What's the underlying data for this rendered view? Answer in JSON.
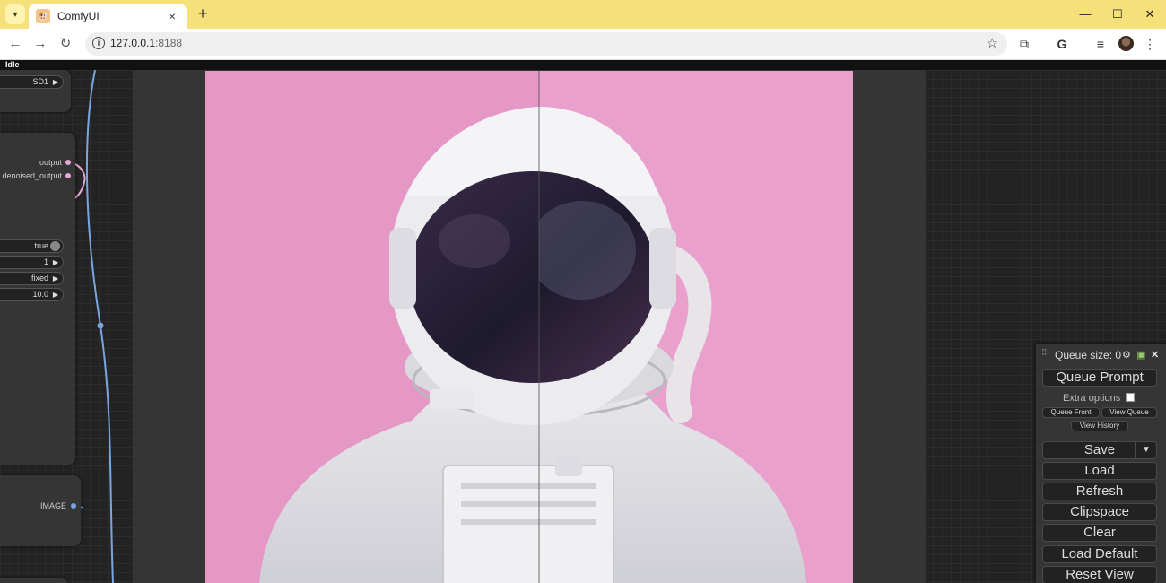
{
  "browser": {
    "tab_title": "ComfyUI",
    "new_tab_label": "+",
    "url_host": "127.0.0.1",
    "url_port": ":8188",
    "icons": [
      "tab-search-icon",
      "favicon-icon",
      "close-icon",
      "minimize-icon",
      "maximize-icon",
      "window-close-icon",
      "back-icon",
      "forward-icon",
      "reload-icon",
      "site-info-icon",
      "bookmark-star-icon",
      "extensions-icon",
      "google-icon",
      "media-controls-icon",
      "profile-avatar",
      "more-menu-icon"
    ]
  },
  "status": {
    "text": "Idle"
  },
  "nodes": {
    "top_node": {
      "model_value": "SD1"
    },
    "sampler_node": {
      "outputs": [
        "output",
        "denoised_output"
      ],
      "widgets": [
        {
          "value": "true",
          "kind": "toggle"
        },
        {
          "value": "1",
          "kind": "number"
        },
        {
          "value": "fixed",
          "kind": "combo"
        },
        {
          "value": "10.0",
          "kind": "number"
        }
      ]
    },
    "image_node": {
      "output_label": "IMAGE"
    }
  },
  "menu": {
    "queue_size_label": "Queue size: 0",
    "queue_prompt": "Queue Prompt",
    "extra_options": "Extra options",
    "queue_front": "Queue Front",
    "view_queue": "View Queue",
    "view_history": "View History",
    "save": "Save",
    "save_dropdown": "▼",
    "load": "Load",
    "refresh": "Refresh",
    "clipspace": "Clipspace",
    "clear": "Clear",
    "load_default": "Load Default",
    "reset_view": "Reset View"
  },
  "colors": {
    "tabbar": "#f6e07a",
    "wire_blue": "#7aa6e0",
    "wire_pink": "#e6a6d6",
    "image_background_pink": "#e597c6"
  }
}
